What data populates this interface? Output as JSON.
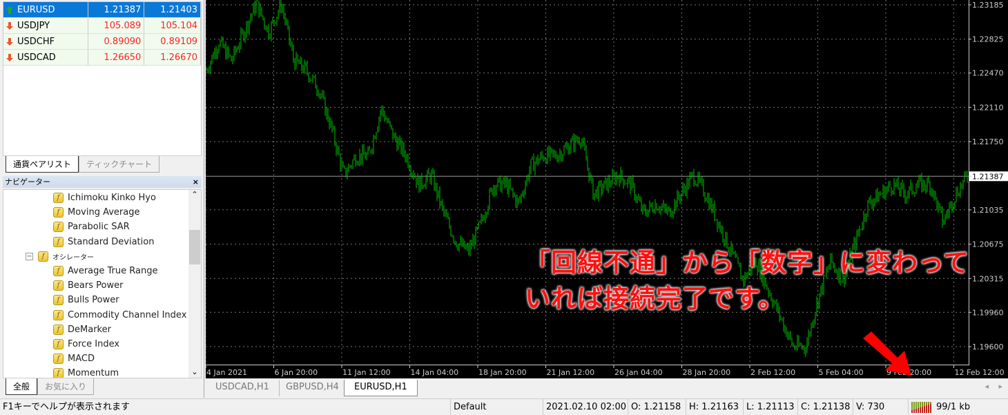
{
  "market_watch": {
    "rows": [
      {
        "symbol": "EURUSD",
        "bid": "1.21387",
        "ask": "1.21403",
        "direction": "up",
        "selected": true
      },
      {
        "symbol": "USDJPY",
        "bid": "105.089",
        "ask": "105.104",
        "direction": "down"
      },
      {
        "symbol": "USDCHF",
        "bid": "0.89090",
        "ask": "0.89109",
        "direction": "down"
      },
      {
        "symbol": "USDCAD",
        "bid": "1.26650",
        "ask": "1.26670",
        "direction": "down"
      }
    ],
    "tabs": [
      "通貨ペアリスト",
      "ティックチャート"
    ]
  },
  "navigator": {
    "title": "ナビゲーター",
    "close": "×",
    "items": [
      "Ichimoku Kinko Hyo",
      "Moving Average",
      "Parabolic SAR",
      "Standard Deviation"
    ],
    "group": "オシレーター",
    "group_items": [
      "Average True Range",
      "Bears Power",
      "Bulls Power",
      "Commodity Channel Index",
      "DeMarker",
      "Force Index",
      "MACD",
      "Momentum"
    ],
    "tabs": [
      "全般",
      "お気に入り"
    ]
  },
  "chart_tabs": [
    "USDCAD,H1",
    "GBPUSD,H4",
    "EURUSD,H1"
  ],
  "status": {
    "help": "F1キーでヘルプが表示されます",
    "profile": "Default",
    "datetime": "2021.02.10 02:00",
    "open": "O: 1.21158",
    "high": "H: 1.21163",
    "low": "L: 1.21113",
    "close": "C: 1.21138",
    "volume": "V: 730",
    "connection": "99/1 kb"
  },
  "annotation": {
    "line1": "「回線不通」から「数字」に変わって",
    "line2": "いれば接続完了です。"
  },
  "chart_data": {
    "type": "bar",
    "symbol": "EURUSD",
    "timeframe": "H1",
    "bar_color": "#00c000",
    "background": "#000000",
    "grid": true,
    "ylim": [
      1.194,
      1.2323
    ],
    "yticks": [
      "1.23185",
      "1.22825",
      "1.22470",
      "1.22110",
      "1.21750",
      "1.21387",
      "1.21035",
      "1.20675",
      "1.20315",
      "1.19960",
      "1.19600"
    ],
    "current_price": "1.21387",
    "xticks": [
      "4 Jan 2021",
      "6 Jan 20:00",
      "11 Jan 12:00",
      "14 Jan 04:00",
      "18 Jan 20:00",
      "21 Jan 12:00",
      "26 Jan 04:00",
      "28 Jan 20:00",
      "2 Feb 12:00",
      "5 Feb 04:00",
      "9 Feb 20:00",
      "12 Feb 12:00"
    ],
    "close_series": [
      1.225,
      1.228,
      1.226,
      1.229,
      1.232,
      1.229,
      1.232,
      1.226,
      1.225,
      1.223,
      1.219,
      1.214,
      1.216,
      1.216,
      1.221,
      1.218,
      1.216,
      1.213,
      1.214,
      1.21,
      1.207,
      1.206,
      1.209,
      1.213,
      1.213,
      1.211,
      1.215,
      1.216,
      1.216,
      1.217,
      1.218,
      1.212,
      1.213,
      1.214,
      1.213,
      1.21,
      1.211,
      1.21,
      1.212,
      1.214,
      1.212,
      1.209,
      1.206,
      1.203,
      1.205,
      1.202,
      1.199,
      1.196,
      1.196,
      1.201,
      1.205,
      1.203,
      1.207,
      1.211,
      1.212,
      1.213,
      1.212,
      1.213,
      1.213,
      1.209,
      1.212,
      1.214
    ]
  }
}
